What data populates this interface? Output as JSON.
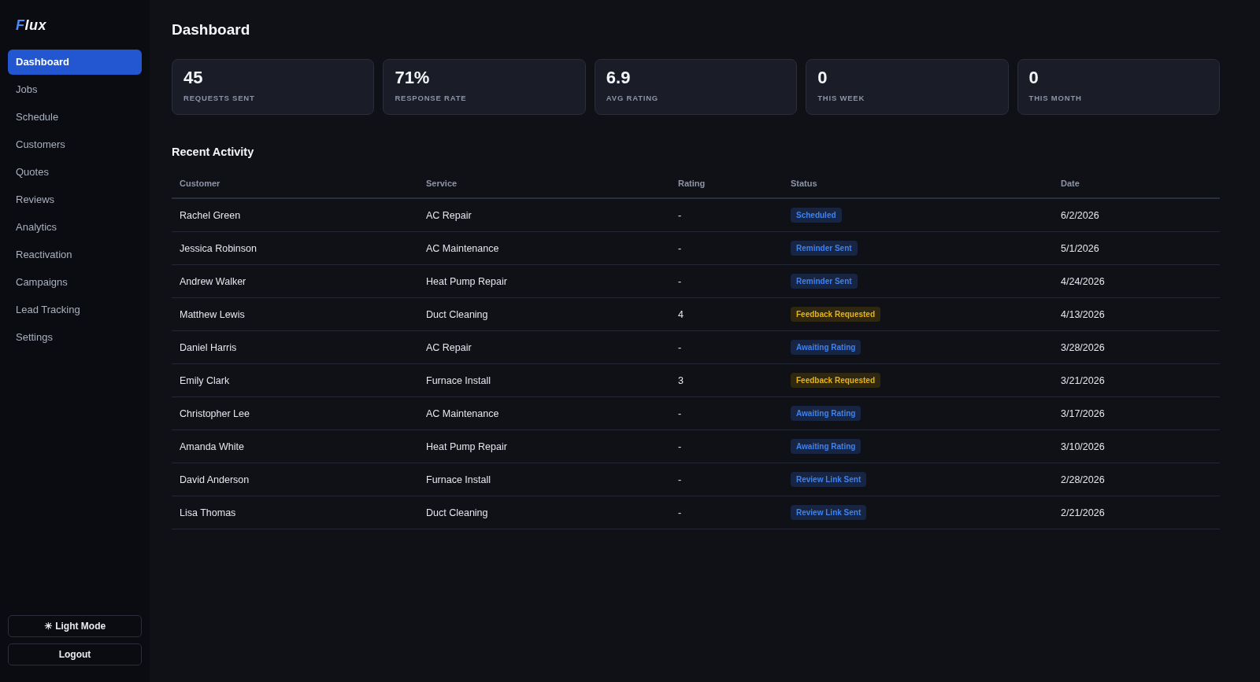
{
  "sidebar": {
    "logo": {
      "accent": "F",
      "rest": "lux"
    },
    "items": [
      {
        "label": "Dashboard",
        "selected": true
      },
      {
        "label": "Jobs",
        "selected": false
      },
      {
        "label": "Schedule",
        "selected": false
      },
      {
        "label": "Customers",
        "selected": false
      },
      {
        "label": "Quotes",
        "selected": false
      },
      {
        "label": "Reviews",
        "selected": false
      },
      {
        "label": "Analytics",
        "selected": false
      },
      {
        "label": "Reactivation",
        "selected": false
      },
      {
        "label": "Campaigns",
        "selected": false
      },
      {
        "label": "Lead Tracking",
        "selected": false
      },
      {
        "label": "Settings",
        "selected": false
      }
    ],
    "buttons": [
      "☀ Light Mode",
      "Logout"
    ]
  },
  "main": {
    "title": "Dashboard",
    "stats": [
      {
        "value": "45",
        "label": "REQUESTS SENT"
      },
      {
        "value": "71%",
        "label": "RESPONSE RATE"
      },
      {
        "value": "6.9",
        "label": "AVG RATING"
      },
      {
        "value": "0",
        "label": "THIS WEEK"
      },
      {
        "value": "0",
        "label": "THIS MONTH"
      }
    ],
    "recent_activity": {
      "title": "Recent Activity",
      "columns": [
        "Customer",
        "Service",
        "Rating",
        "Status",
        "Date"
      ],
      "rows": [
        {
          "customer": "Rachel Green",
          "service": "AC Repair",
          "rating": "-",
          "status": {
            "label": "Scheduled",
            "kind": "info"
          },
          "date": "6/2/2026"
        },
        {
          "customer": "Jessica Robinson",
          "service": "AC Maintenance",
          "rating": "-",
          "status": {
            "label": "Reminder Sent",
            "kind": "info"
          },
          "date": "5/1/2026"
        },
        {
          "customer": "Andrew Walker",
          "service": "Heat Pump Repair",
          "rating": "-",
          "status": {
            "label": "Reminder Sent",
            "kind": "info"
          },
          "date": "4/24/2026"
        },
        {
          "customer": "Matthew Lewis",
          "service": "Duct Cleaning",
          "rating": "4",
          "status": {
            "label": "Feedback Requested",
            "kind": "warning"
          },
          "date": "4/13/2026"
        },
        {
          "customer": "Daniel Harris",
          "service": "AC Repair",
          "rating": "-",
          "status": {
            "label": "Awaiting Rating",
            "kind": "info"
          },
          "date": "3/28/2026"
        },
        {
          "customer": "Emily Clark",
          "service": "Furnace Install",
          "rating": "3",
          "status": {
            "label": "Feedback Requested",
            "kind": "warning"
          },
          "date": "3/21/2026"
        },
        {
          "customer": "Christopher Lee",
          "service": "AC Maintenance",
          "rating": "-",
          "status": {
            "label": "Awaiting Rating",
            "kind": "info"
          },
          "date": "3/17/2026"
        },
        {
          "customer": "Amanda White",
          "service": "Heat Pump Repair",
          "rating": "-",
          "status": {
            "label": "Awaiting Rating",
            "kind": "info"
          },
          "date": "3/10/2026"
        },
        {
          "customer": "David Anderson",
          "service": "Furnace Install",
          "rating": "-",
          "status": {
            "label": "Review Link Sent",
            "kind": "info"
          },
          "date": "2/28/2026"
        },
        {
          "customer": "Lisa Thomas",
          "service": "Duct Cleaning",
          "rating": "-",
          "status": {
            "label": "Review Link Sent",
            "kind": "info"
          },
          "date": "2/21/2026"
        }
      ]
    }
  }
}
